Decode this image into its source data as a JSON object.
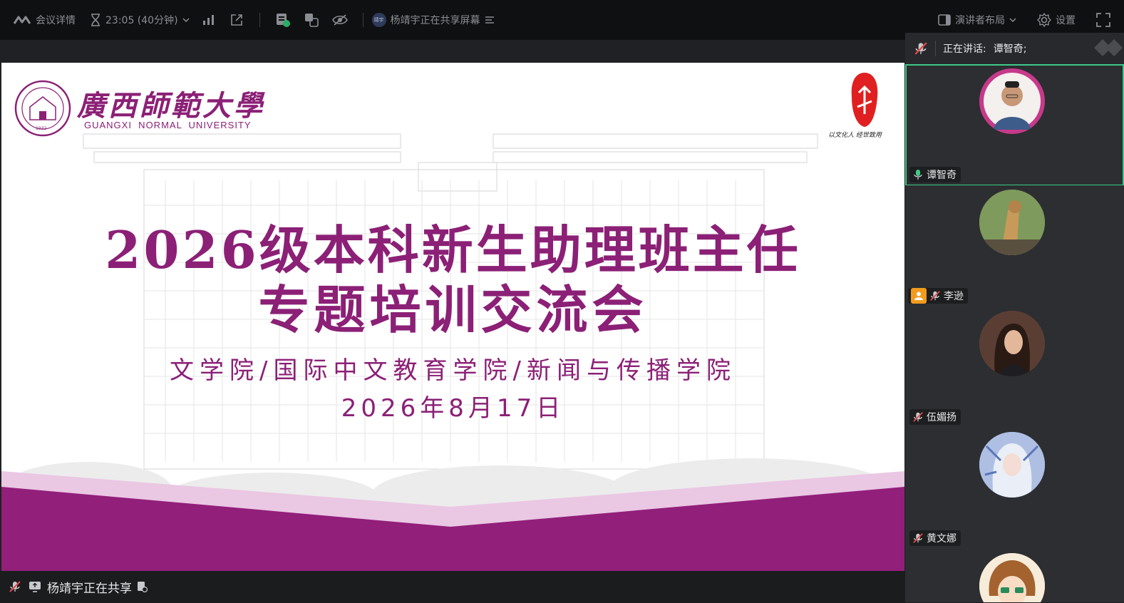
{
  "topbar": {
    "meeting_info": "会议详情",
    "timer": "23:05 (40分钟)",
    "sharing_status": "杨靖宇正在共享屏幕",
    "sharer_avatar_text": "靖宇",
    "layout_label": "演讲者布局",
    "settings_label": "设置"
  },
  "slide": {
    "university_cn": "廣西師範大學",
    "university_en": "GUANGXI  NORMAL  UNIVERSITY",
    "seal_year": "1932",
    "motto": "以文化人 经世致用",
    "title_line1": "2026级本科新生助理班主任",
    "title_line2": "专题培训交流会",
    "subtitle_line1": "文学院/国际中文教育学院/新闻与传播学院",
    "subtitle_line2": "2026年8月17日"
  },
  "share_bar": {
    "text": "杨靖宇正在共享"
  },
  "sidebar": {
    "speaking_label": "正在讲话:",
    "speaking_name": "谭智奇;",
    "participants": [
      {
        "name": "谭智奇",
        "mic": "speaking",
        "active": true
      },
      {
        "name": "李逊",
        "mic": "muted",
        "active": false
      },
      {
        "name": "伍媚扬",
        "mic": "muted",
        "active": false
      },
      {
        "name": "黄文娜",
        "mic": "muted",
        "active": false
      },
      {
        "name": "",
        "mic": "muted",
        "active": false
      }
    ]
  },
  "colors": {
    "brand_purple": "#8b2076",
    "light_pink": "#eac7e3",
    "active_border": "#3ec98a",
    "mic_muted": "#e04a4a",
    "orange_badge": "#f29b1d"
  }
}
